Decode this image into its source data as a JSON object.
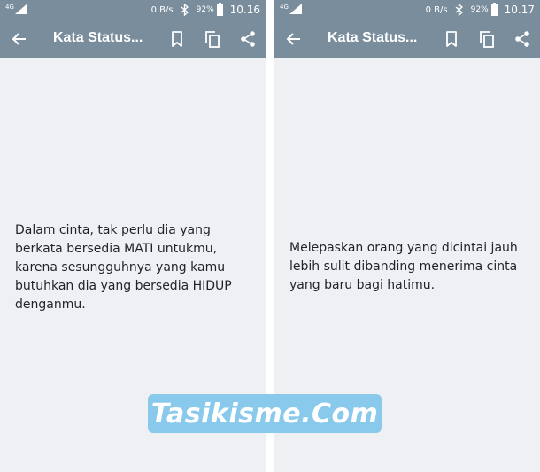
{
  "screens": [
    {
      "status": {
        "network": "4G",
        "speed": "0 B/s",
        "battery_percent": "92%",
        "battery_level": 0.92,
        "time": "10.16"
      },
      "toolbar": {
        "title": "Kata Status..."
      },
      "quote": "Dalam cinta, tak perlu dia yang berkata bersedia MATI untukmu, karena sesungguhnya yang kamu butuhkan dia yang bersedia HIDUP denganmu."
    },
    {
      "status": {
        "network": "4G",
        "speed": "0 B/s",
        "battery_percent": "92%",
        "battery_level": 0.92,
        "time": "10.17"
      },
      "toolbar": {
        "title": "Kata Status..."
      },
      "quote": "Melepaskan orang yang dicintai jauh lebih sulit dibanding menerima cinta yang baru bagi hatimu."
    }
  ],
  "watermark": "Tasikisme.Com",
  "colors": {
    "bar": "#7a8d9c",
    "background": "#eff0f4",
    "text": "#1f2328",
    "watermark_bg": "#89c9ec"
  },
  "icons": [
    "back-arrow-icon",
    "bookmark-icon",
    "copy-icon",
    "share-icon",
    "bluetooth-icon",
    "signal-icon",
    "battery-icon"
  ]
}
